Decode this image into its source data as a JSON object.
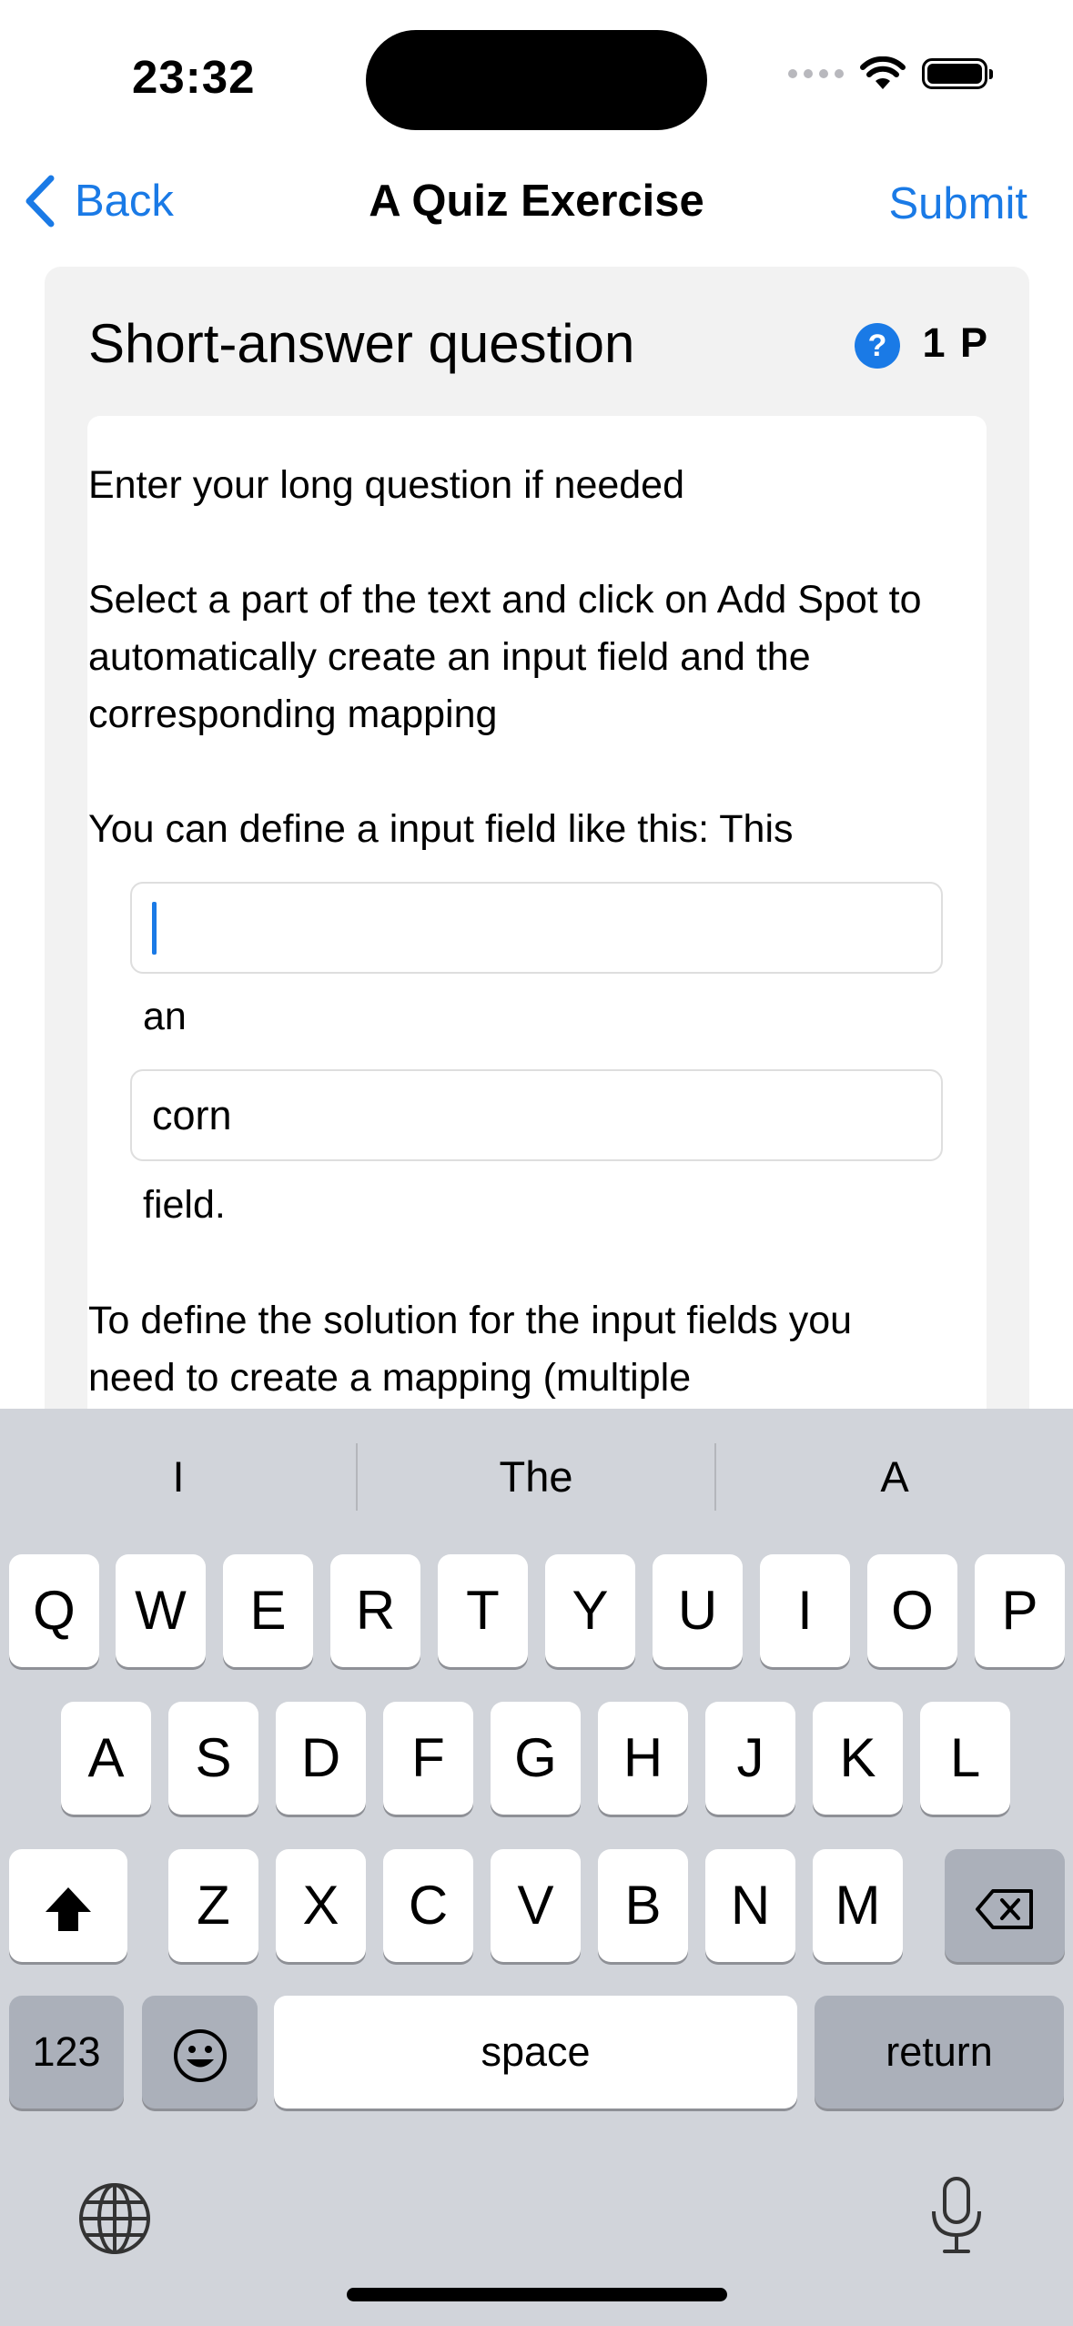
{
  "status": {
    "time": "23:32"
  },
  "nav": {
    "back_label": "Back",
    "title": "A Quiz Exercise",
    "submit_label": "Submit"
  },
  "question": {
    "type_label": "Short-answer question",
    "help": "?",
    "points": "1 P",
    "line1": "Enter your long question if needed",
    "para2": "Select a part of the text and click on Add Spot to automatically create an input field and the corresponding mapping",
    "line3": "You can define a input field like this: This",
    "field1_value": "",
    "word_an": "an",
    "field2_value": "corn",
    "word_field": "field.",
    "para4": "To define the solution for the input fields you need to create a mapping (multiple"
  },
  "keyboard": {
    "suggestions": [
      "I",
      "The",
      "A"
    ],
    "row1": [
      "Q",
      "W",
      "E",
      "R",
      "T",
      "Y",
      "U",
      "I",
      "O",
      "P"
    ],
    "row2": [
      "A",
      "S",
      "D",
      "F",
      "G",
      "H",
      "J",
      "K",
      "L"
    ],
    "row3": [
      "Z",
      "X",
      "C",
      "V",
      "B",
      "N",
      "M"
    ],
    "numbers_label": "123",
    "space_label": "space",
    "return_label": "return"
  },
  "colors": {
    "accent": "#1a7ae6",
    "keyboard_bg": "#d1d4da",
    "card_bg": "#f2f2f2"
  }
}
